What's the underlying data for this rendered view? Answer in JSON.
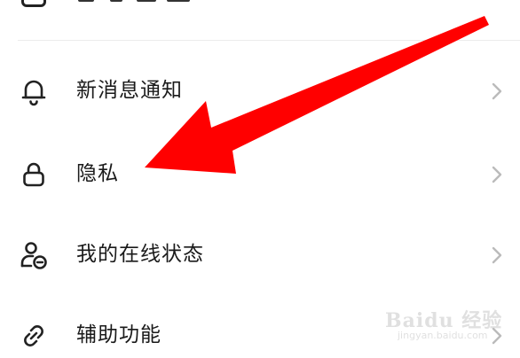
{
  "menu": {
    "items": [
      {
        "label": "新消息通知",
        "icon": "bell-icon"
      },
      {
        "label": "隐私",
        "icon": "lock-icon"
      },
      {
        "label": "我的在线状态",
        "icon": "user-status-icon"
      },
      {
        "label": "辅助功能",
        "icon": "link-icon"
      }
    ],
    "chevron_icon": "chevron-right-icon"
  },
  "annotation": {
    "arrow_color": "#ff0000",
    "target": "隐私"
  },
  "colors": {
    "background": "#ffffff",
    "text": "#1a1a1a",
    "icon": "#222222",
    "chevron": "#bbbbbb",
    "divider": "#ececec"
  },
  "watermark": {
    "main": "Baidu 经验",
    "sub": "jingyan.baidu.com"
  }
}
